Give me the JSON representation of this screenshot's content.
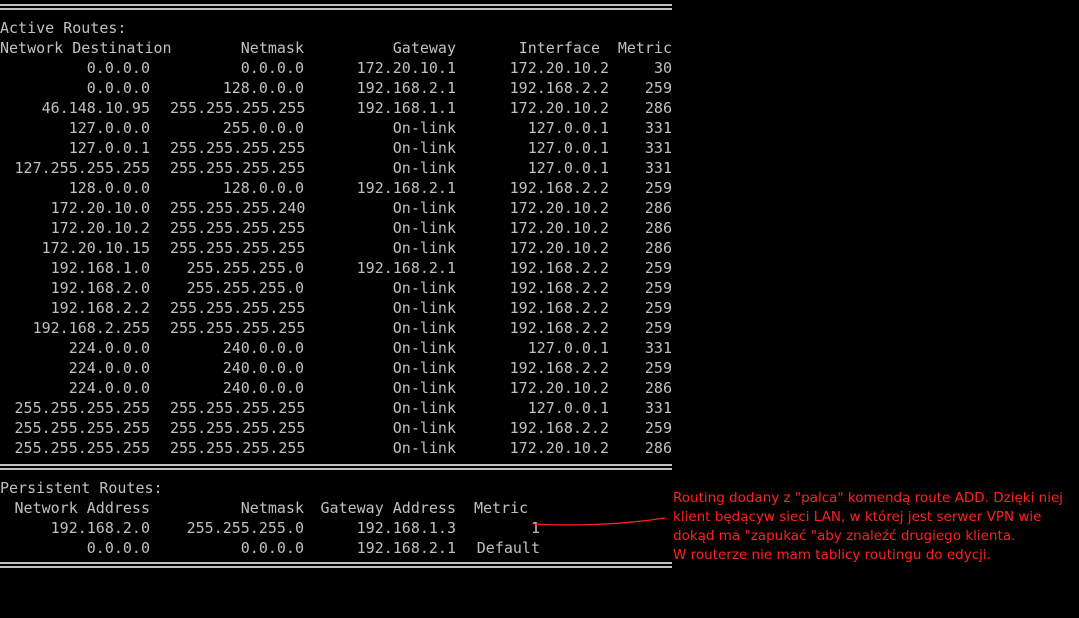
{
  "active": {
    "title": "Active Routes:",
    "headers": [
      "Network Destination",
      "Netmask",
      "Gateway",
      "Interface",
      "Metric"
    ],
    "rows": [
      [
        "0.0.0.0",
        "0.0.0.0",
        "172.20.10.1",
        "172.20.10.2",
        "30"
      ],
      [
        "0.0.0.0",
        "128.0.0.0",
        "192.168.2.1",
        "192.168.2.2",
        "259"
      ],
      [
        "46.148.10.95",
        "255.255.255.255",
        "192.168.1.1",
        "172.20.10.2",
        "286"
      ],
      [
        "127.0.0.0",
        "255.0.0.0",
        "On-link",
        "127.0.0.1",
        "331"
      ],
      [
        "127.0.0.1",
        "255.255.255.255",
        "On-link",
        "127.0.0.1",
        "331"
      ],
      [
        "127.255.255.255",
        "255.255.255.255",
        "On-link",
        "127.0.0.1",
        "331"
      ],
      [
        "128.0.0.0",
        "128.0.0.0",
        "192.168.2.1",
        "192.168.2.2",
        "259"
      ],
      [
        "172.20.10.0",
        "255.255.255.240",
        "On-link",
        "172.20.10.2",
        "286"
      ],
      [
        "172.20.10.2",
        "255.255.255.255",
        "On-link",
        "172.20.10.2",
        "286"
      ],
      [
        "172.20.10.15",
        "255.255.255.255",
        "On-link",
        "172.20.10.2",
        "286"
      ],
      [
        "192.168.1.0",
        "255.255.255.0",
        "192.168.2.1",
        "192.168.2.2",
        "259"
      ],
      [
        "192.168.2.0",
        "255.255.255.0",
        "On-link",
        "192.168.2.2",
        "259"
      ],
      [
        "192.168.2.2",
        "255.255.255.255",
        "On-link",
        "192.168.2.2",
        "259"
      ],
      [
        "192.168.2.255",
        "255.255.255.255",
        "On-link",
        "192.168.2.2",
        "259"
      ],
      [
        "224.0.0.0",
        "240.0.0.0",
        "On-link",
        "127.0.0.1",
        "331"
      ],
      [
        "224.0.0.0",
        "240.0.0.0",
        "On-link",
        "192.168.2.2",
        "259"
      ],
      [
        "224.0.0.0",
        "240.0.0.0",
        "On-link",
        "172.20.10.2",
        "286"
      ],
      [
        "255.255.255.255",
        "255.255.255.255",
        "On-link",
        "127.0.0.1",
        "331"
      ],
      [
        "255.255.255.255",
        "255.255.255.255",
        "On-link",
        "192.168.2.2",
        "259"
      ],
      [
        "255.255.255.255",
        "255.255.255.255",
        "On-link",
        "172.20.10.2",
        "286"
      ]
    ]
  },
  "persistent": {
    "title": "Persistent Routes:",
    "headers": [
      "Network Address",
      "Netmask",
      "Gateway Address",
      "Metric"
    ],
    "rows": [
      [
        "192.168.2.0",
        "255.255.255.0",
        "192.168.1.3",
        "1"
      ],
      [
        "0.0.0.0",
        "0.0.0.0",
        "192.168.2.1",
        "Default"
      ]
    ]
  },
  "annotation": {
    "lines": [
      "Routing dodany z \"palca\" komendą route ADD. Dzięki niej",
      "klient będącyw sieci LAN, w której jest serwer VPN wie",
      "dokąd ma \"zapukać \"aby znaleźć drugiego klienta.",
      "W routerze nie mam tablicy routingu do edycji."
    ]
  },
  "colors": {
    "background": "#000000",
    "console_text": "#c0c0c0",
    "annotation": "#ff2020"
  }
}
